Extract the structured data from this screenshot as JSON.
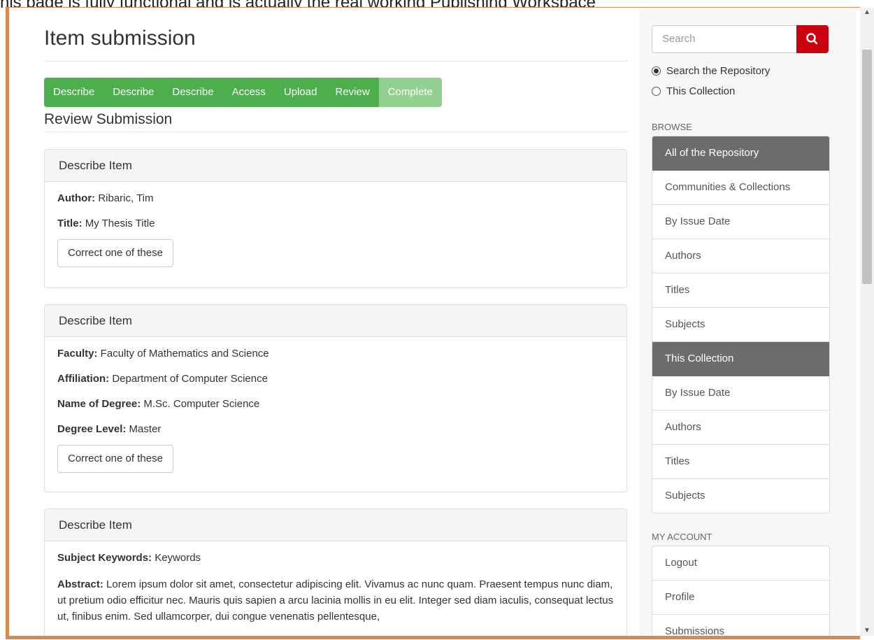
{
  "top_strip_text": "his page is fully functional and is actually the real working Publishing Workspace",
  "page": {
    "title": "Item submission",
    "progress_steps": [
      "Describe",
      "Describe",
      "Describe",
      "Access",
      "Upload",
      "Review",
      "Complete"
    ],
    "subtitle": "Review Submission",
    "panels": [
      {
        "heading": "Describe Item",
        "fields": [
          {
            "label": "Author:",
            "value": " Ribaric, Tim"
          },
          {
            "label": "Title:",
            "value": " My Thesis Title"
          }
        ],
        "button": "Correct one of these"
      },
      {
        "heading": "Describe Item",
        "fields": [
          {
            "label": "Faculty:",
            "value": " Faculty of Mathematics and Science"
          },
          {
            "label": "Affiliation:",
            "value": " Department of Computer Science"
          },
          {
            "label": "Name of Degree:",
            "value": " M.Sc. Computer Science"
          },
          {
            "label": "Degree Level:",
            "value": " Master"
          }
        ],
        "button": "Correct one of these"
      },
      {
        "heading": "Describe Item",
        "fields": [
          {
            "label": "Subject Keywords:",
            "value": " Keywords"
          },
          {
            "label": "Abstract:",
            "value": " Lorem ipsum dolor sit amet, consectetur adipiscing elit. Vivamus ac nunc quam. Praesent tempus nunc diam, ut pretium odio efficitur nec. Mauris quis sapien a arcu lacinia mollis in eu elit. Integer sed diam iaculis, consequat lectus ut, finibus enim. Sed ullamcorper, dui congue venenatis pellentesque,"
          }
        ]
      }
    ]
  },
  "sidebar": {
    "search_placeholder": "Search",
    "search_icon": "magnifier-icon",
    "scope_repository": "Search the Repository",
    "scope_collection": "This Collection",
    "browse_label": "BROWSE",
    "browse_items": [
      "All of the Repository",
      "Communities & Collections",
      "By Issue Date",
      "Authors",
      "Titles",
      "Subjects",
      "This Collection",
      "By Issue Date",
      "Authors",
      "Titles",
      "Subjects"
    ],
    "account_label": "MY ACCOUNT",
    "account_items": [
      "Logout",
      "Profile",
      "Submissions"
    ]
  },
  "colors": {
    "progress_active": "#4cae4c",
    "progress_complete": "#92d192",
    "search_button": "#c9000d",
    "list_header": "#6c6c6c",
    "frame": "#d98a4e"
  }
}
